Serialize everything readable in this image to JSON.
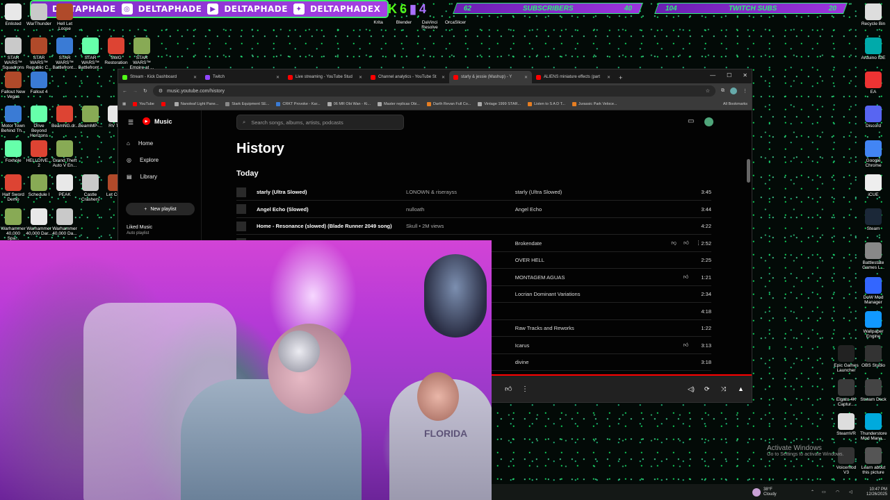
{
  "banner": {
    "handles": [
      "DELTAPHADE",
      "DELTAPHADE",
      "DELTAPHADE",
      "DELTAPHADEX"
    ],
    "subs_left": "62",
    "subs_label": "SUBSCRIBERS",
    "subs_right": "40",
    "twitch_left": "104",
    "twitch_label": "TWITCH SUBS",
    "twitch_right": "20",
    "k_value": "6",
    "t_value": "4"
  },
  "desktop_left": [
    [
      "Enlisted",
      "WarThunder",
      "Hell Let Loose"
    ],
    [
      "STAR WARS™ Squadrons",
      "STAR WARS™ Republic C...",
      "STAR WARS™ Battlefront...",
      "STAR WARS™ Battlefront...",
      "SWG Restoration",
      "STAR WARS™ Empire at ..."
    ],
    [
      "Fallout New Vegas",
      "Fallout 4"
    ],
    [
      "Motor Town Behind Th...",
      "Drive Beyond Horizons",
      "BeamNG.dr...",
      "BeamMP-...",
      "RV The"
    ],
    [
      "Foxhole",
      "HELLDIVE... 2",
      "Grand Theft Auto V En..."
    ],
    [
      "Half Sword Demo",
      "Schedule I",
      "PEAK",
      "Castle Crashers",
      "Let Comp"
    ],
    [
      "Warhammer 40,000 Spa...",
      "Warhammer 40,000 Dar...",
      "Warhammer 40,000 Da..."
    ]
  ],
  "desktop_top": [
    "Krita",
    "Blender",
    "DaVinci Resolve",
    "OrcaSlicer"
  ],
  "desktop_right": [
    "Recycle Bin",
    "Arduino IDE",
    "EA",
    "Discord",
    "Google Chrome",
    "iCUE",
    "Steam",
    "Battlestate Games L...",
    "DoW Mod Manager",
    "Wallpaper Engine",
    "OBS Studio",
    "Epic Games Launcher",
    "Stream Deck",
    "Elgato 4K Captur...",
    "Thunderstore Mod Mana...",
    "SteamVR",
    "Learn about this picture",
    "Voicemod V3"
  ],
  "browser": {
    "tabs": [
      {
        "label": "Stream - Kick Dashboard",
        "color": "#53fc18"
      },
      {
        "label": "Twitch",
        "color": "#9146ff"
      },
      {
        "label": "Live streaming - YouTube Stud",
        "color": "#ff0000"
      },
      {
        "label": "Channel analytics - YouTube St",
        "color": "#ff0000"
      },
      {
        "label": "starly & jessie (Mashup) - Y",
        "color": "#ff0000"
      },
      {
        "label": "ALIENS miniature effects (part",
        "color": "#ff0000"
      }
    ],
    "url": "music.youtube.com/history",
    "bookmarks": [
      {
        "label": "YouTube",
        "color": "#f00"
      },
      {
        "label": "",
        "color": "#f00"
      },
      {
        "label": "Nanoleaf Light Pane...",
        "color": "#aaa"
      },
      {
        "label": "Stark Equipment SE...",
        "color": "#888"
      },
      {
        "label": "CRKT Provoke - Kar...",
        "color": "#3a7bd5"
      },
      {
        "label": "06 MR Obi Wan - Ki...",
        "color": "#aaa"
      },
      {
        "label": "Master replicas Obi...",
        "color": "#aaa"
      },
      {
        "label": "Darth Revan Full Co...",
        "color": "#e67e22"
      },
      {
        "label": "Vintage 1999 STAR...",
        "color": "#aaa"
      },
      {
        "label": "Listen to S A D T...",
        "color": "#e67e22"
      },
      {
        "label": "Jurassic Park Veloce...",
        "color": "#e67e22"
      }
    ],
    "all_bookmarks": "All Bookmarks"
  },
  "ytm": {
    "logo": "Music",
    "nav": [
      "Home",
      "Explore",
      "Library"
    ],
    "new_playlist": "New playlist",
    "liked": "Liked Music",
    "liked_sub": "Auto playlist",
    "search_placeholder": "Search songs, albums, artists, podcasts",
    "title": "History",
    "section": "Today",
    "rows": [
      {
        "title": "starly (Ultra Slowed)",
        "artist": "LONOWN & riserayss",
        "album": "starly (Ultra Slowed)",
        "duration": "3:45"
      },
      {
        "title": "Angel Echo (Slowed)",
        "artist": "nulloath",
        "album": "Angel Echo",
        "duration": "3:44"
      },
      {
        "title": "Home - Resonance (slowed) (Blade Runner 2049 song)",
        "artist": "Skull • 2M views",
        "album": "",
        "duration": "4:22"
      },
      {
        "title": "",
        "artist": "",
        "album": "Brokendate",
        "duration": "2:52"
      },
      {
        "title": "",
        "artist": "",
        "album": "OVER HELL",
        "duration": "2:25"
      },
      {
        "title": "",
        "artist": "",
        "album": "MONTAGEM AGUAS",
        "duration": "1:21"
      },
      {
        "title": "",
        "artist": "",
        "album": "Locrian Dominant Variations",
        "duration": "2:34"
      },
      {
        "title": "",
        "artist": "",
        "album": "",
        "duration": "4:18"
      },
      {
        "title": "",
        "artist": "",
        "album": "Raw Tracks and Reworks",
        "duration": "1:22"
      },
      {
        "title": "",
        "artist": "",
        "album": "Icarus",
        "duration": "3:13"
      },
      {
        "title": "",
        "artist": "",
        "album": "divine",
        "duration": "3:18"
      }
    ]
  },
  "camera": {
    "shirt_text": "FLORIDA"
  },
  "windows": {
    "activate_title": "Activate Windows",
    "activate_sub": "Go to Settings to activate Windows."
  },
  "taskbar": {
    "weather_temp": "38°F",
    "weather_desc": "Cloudy",
    "time": "10:47 PM",
    "date": "12/26/2025"
  }
}
